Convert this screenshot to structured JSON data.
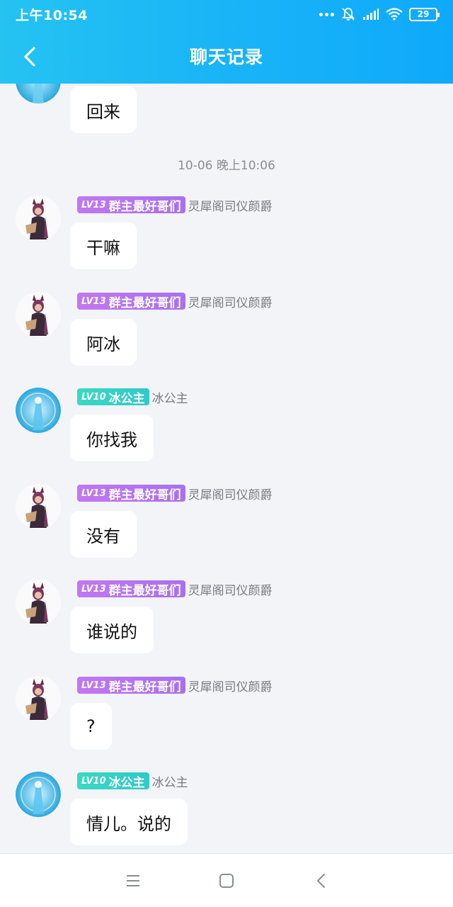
{
  "status_bar": {
    "time": "上午10:54",
    "battery": "29",
    "icons": [
      "more-dots-icon",
      "mute-bell-icon",
      "signal-icon",
      "wifi-icon",
      "battery-icon"
    ]
  },
  "header": {
    "title": "聊天记录",
    "back_icon": "chevron-left-icon"
  },
  "colors": {
    "header_gradient": [
      "#25c3f2",
      "#0fa9fb"
    ],
    "background": "#f3f4f8",
    "badge_purple": "#b874f0",
    "badge_teal": "#33cfc7"
  },
  "chat": {
    "top_partial_message": "回来",
    "time_divider": "10-06 晚上10:06",
    "messages": [
      {
        "level": "LV13",
        "title": "群主最好哥们",
        "nickname": "灵犀阁司仪颜爵",
        "text": "干嘛",
        "badge": "purple",
        "avatar": "robed-character-avatar"
      },
      {
        "level": "LV13",
        "title": "群主最好哥们",
        "nickname": "灵犀阁司仪颜爵",
        "text": "阿冰",
        "badge": "purple",
        "avatar": "robed-character-avatar"
      },
      {
        "level": "LV10",
        "title": "冰公主",
        "nickname": "冰公主",
        "text": "你找我",
        "badge": "teal",
        "avatar": "ice-princess-avatar"
      },
      {
        "level": "LV13",
        "title": "群主最好哥们",
        "nickname": "灵犀阁司仪颜爵",
        "text": "没有",
        "badge": "purple",
        "avatar": "robed-character-avatar"
      },
      {
        "level": "LV13",
        "title": "群主最好哥们",
        "nickname": "灵犀阁司仪颜爵",
        "text": "谁说的",
        "badge": "purple",
        "avatar": "robed-character-avatar"
      },
      {
        "level": "LV13",
        "title": "群主最好哥们",
        "nickname": "灵犀阁司仪颜爵",
        "text": "?",
        "badge": "purple",
        "avatar": "robed-character-avatar"
      },
      {
        "level": "LV10",
        "title": "冰公主",
        "nickname": "冰公主",
        "text": "情儿。说的",
        "badge": "teal",
        "avatar": "ice-princess-avatar"
      }
    ]
  },
  "system_nav": {
    "buttons": [
      "menu-icon",
      "home-square-icon",
      "back-triangle-icon"
    ]
  }
}
